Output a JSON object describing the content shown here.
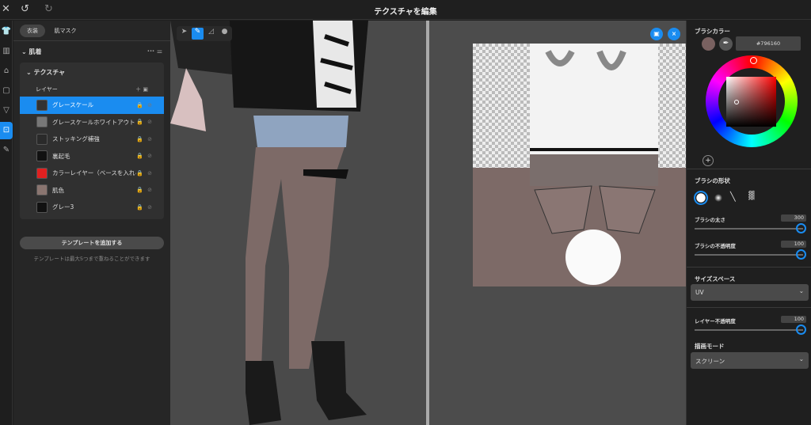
{
  "header": {
    "title": "テクスチャを編集",
    "close_icon": "close-icon",
    "undo_icon": "undo-icon",
    "redo_icon": "redo-icon"
  },
  "rail": [
    "shirt-icon",
    "pants-icon",
    "shoe-icon",
    "dress-icon",
    "underwear-icon",
    "texture-icon",
    "brush-icon"
  ],
  "left": {
    "tabs": [
      {
        "label": "衣装",
        "active": true
      },
      {
        "label": "肌マスク",
        "active": false
      }
    ],
    "section": "肌着",
    "texture_header": "テクスチャ",
    "layers_label": "レイヤー",
    "layers": [
      {
        "name": "グレースケール",
        "selected": true,
        "thumb": "#333333"
      },
      {
        "name": "グレースケールホワイトアウト",
        "selected": false,
        "thumb": "#777777"
      },
      {
        "name": "ストッキング補強",
        "selected": false,
        "thumb": "#2a2a2a"
      },
      {
        "name": "裏起毛",
        "selected": false,
        "thumb": "#111111"
      },
      {
        "name": "カラーレイヤー（ベースを入れる）",
        "selected": false,
        "thumb": "#e02020"
      },
      {
        "name": "肌色",
        "selected": false,
        "thumb": "#8a7570"
      },
      {
        "name": "グレー3",
        "selected": false,
        "thumb": "#111111"
      }
    ],
    "add_template": "テンプレートを追加する",
    "template_note": "テンプレートは最大5つまで重ねることができます"
  },
  "viewport_tools": [
    "select-icon",
    "pen-icon",
    "eraser-icon",
    "fill-icon"
  ],
  "right": {
    "brush_color_label": "ブラシカラー",
    "color_hex": "#796160",
    "brush_shape_label": "ブラシの形状",
    "brush_size_label": "ブラシの太さ",
    "brush_size": "300",
    "brush_opacity_label": "ブラシの不透明度",
    "brush_opacity": "100",
    "size_space_label": "サイズスペース",
    "size_space": "UV",
    "layer_opacity_label": "レイヤー不透明度",
    "layer_opacity": "100",
    "draw_mode_label": "描画モード",
    "draw_mode": "スクリーン"
  },
  "colors": {
    "accent": "#1a8cf0",
    "brush": "#796160"
  }
}
